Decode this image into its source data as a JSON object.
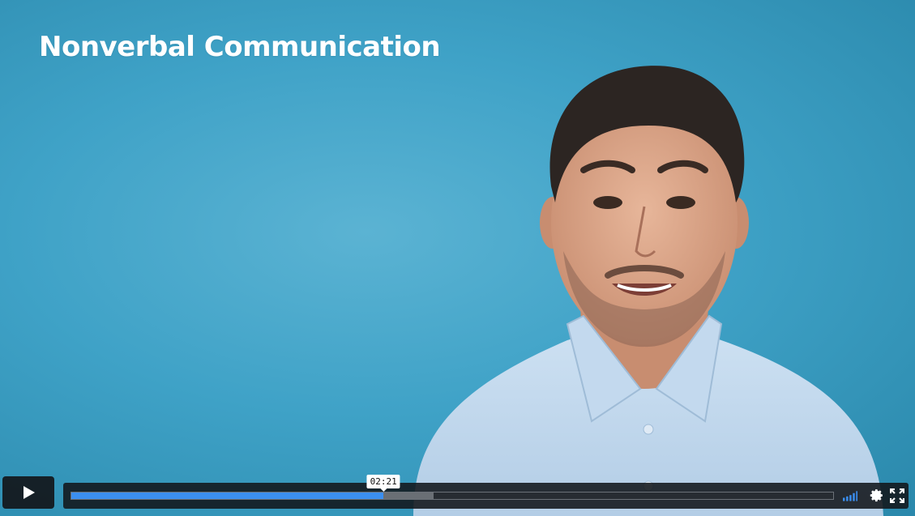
{
  "video": {
    "title": "Nonverbal Communication",
    "background_color": "#3fa2c7"
  },
  "controls": {
    "play_icon": "play-icon",
    "hover_time": "02:21",
    "played_fraction": 0.41,
    "buffered_fraction": 0.475,
    "accent_color": "#3b8ff0",
    "volume_icon": "volume-bars-icon",
    "settings_icon": "gear-icon",
    "fullscreen_icon": "fullscreen-icon"
  }
}
